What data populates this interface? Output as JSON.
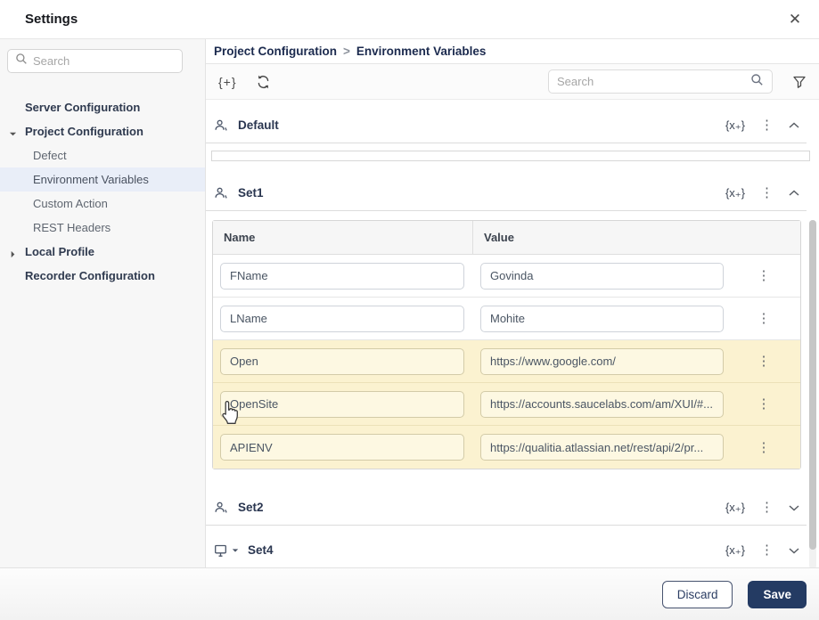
{
  "window": {
    "title": "Settings"
  },
  "icons": {
    "close": "✕",
    "add_variable_set": "{+}",
    "variable_add": "{x₊}",
    "kebab": "⋮",
    "breadcrumb_separator": ">"
  },
  "sidebar": {
    "search_placeholder": "Search",
    "items": [
      {
        "label": "Server Configuration",
        "level": 0
      },
      {
        "label": "Project Configuration",
        "level": 0,
        "state": "expanded"
      },
      {
        "label": "Defect",
        "level": 1
      },
      {
        "label": "Environment Variables",
        "level": 1,
        "state": "selected"
      },
      {
        "label": "Custom Action",
        "level": 1
      },
      {
        "label": "REST Headers",
        "level": 1
      },
      {
        "label": "Local Profile",
        "level": 0,
        "state": "collapsed"
      },
      {
        "label": "Recorder Configuration",
        "level": 0
      }
    ]
  },
  "breadcrumb": {
    "parent": "Project Configuration",
    "current": "Environment Variables"
  },
  "toolbar": {
    "search_placeholder": "Search"
  },
  "sections": {
    "default": {
      "label": "Default",
      "expanded": true
    },
    "set1": {
      "label": "Set1",
      "expanded": true,
      "table": {
        "headers": {
          "name": "Name",
          "value": "Value"
        },
        "rows": [
          {
            "name": "FName",
            "value": "Govinda",
            "highlight": false
          },
          {
            "name": "LName",
            "value": "Mohite",
            "highlight": false
          },
          {
            "name": "Open",
            "value": "https://www.google.com/",
            "highlight": true
          },
          {
            "name": "OpenSite",
            "value": "https://accounts.saucelabs.com/am/XUI/#...",
            "highlight": true
          },
          {
            "name": "APIENV",
            "value": "https://qualitia.atlassian.net/rest/api/2/pr...",
            "highlight": true
          }
        ]
      }
    },
    "set2": {
      "label": "Set2",
      "expanded": false
    },
    "set4": {
      "label": "Set4",
      "expanded": false
    }
  },
  "footer": {
    "discard": "Discard",
    "save": "Save"
  },
  "colors": {
    "brand_navy": "#243b63",
    "breadcrumb_text": "#1b2a4e",
    "row_highlight": "#fbf2d0",
    "selected_nav_bg": "#e9eef8"
  }
}
